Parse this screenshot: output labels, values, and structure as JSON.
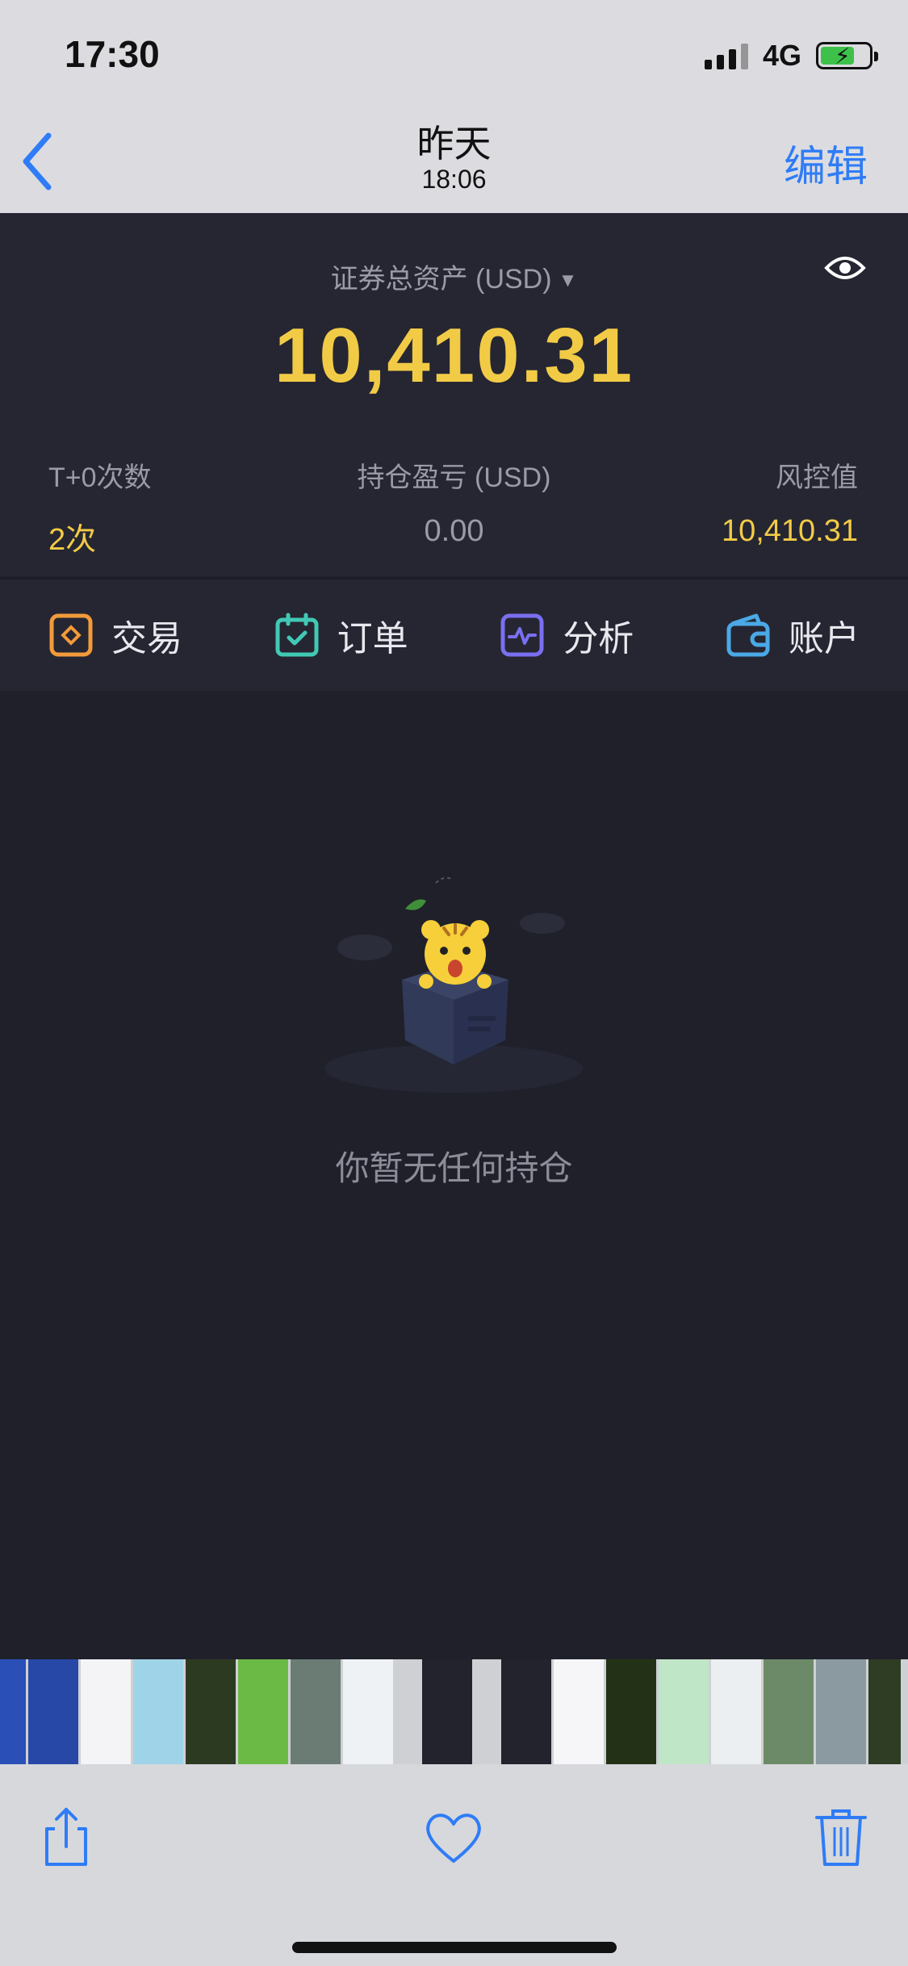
{
  "status_bar": {
    "time": "17:30",
    "network": "4G"
  },
  "nav": {
    "title": "昨天",
    "subtitle": "18:06",
    "edit_label": "编辑"
  },
  "summary": {
    "asset_label": "证券总资产 (USD)",
    "asset_value": "10,410.31",
    "stats": [
      {
        "label": "T+0次数",
        "value": "2次"
      },
      {
        "label": "持仓盈亏 (USD)",
        "value": "0.00"
      },
      {
        "label": "风控值",
        "value": "10,410.31"
      }
    ]
  },
  "tabs": [
    {
      "label": "交易",
      "icon": "trade-icon",
      "color": "#f39a3b"
    },
    {
      "label": "订单",
      "icon": "order-icon",
      "color": "#41c9b5"
    },
    {
      "label": "分析",
      "icon": "analysis-icon",
      "color": "#7a6ff0"
    },
    {
      "label": "账户",
      "icon": "wallet-icon",
      "color": "#4aa9e6"
    }
  ],
  "empty_state": {
    "text": "你暂无任何持仓",
    "illustration": "tiger-in-box-icon"
  },
  "photo_toolbar": {
    "share": "share-icon",
    "favorite": "heart-icon",
    "delete": "trash-icon"
  },
  "colors": {
    "accent_gold": "#f2cb46",
    "ios_blue": "#2f7cf6",
    "panel": "#252632",
    "background": "#1f202a"
  }
}
